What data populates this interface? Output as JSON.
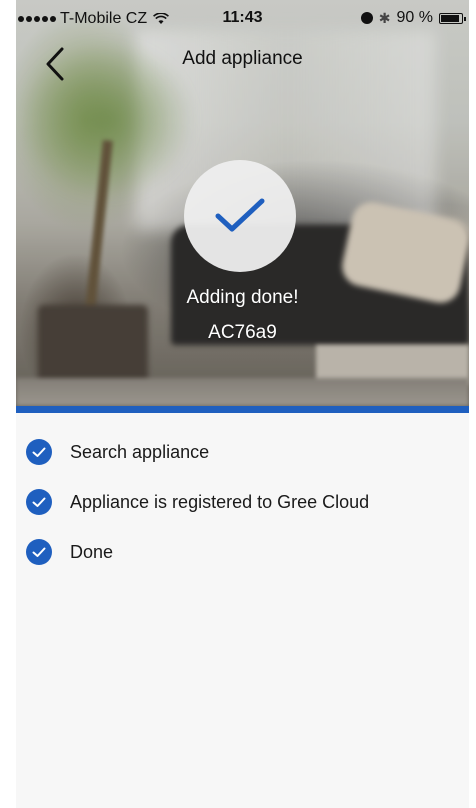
{
  "status_bar": {
    "carrier": "T-Mobile CZ",
    "time": "11:43",
    "battery": "90 %"
  },
  "nav": {
    "title": "Add appliance"
  },
  "result": {
    "message": "Adding done!",
    "device_id": "AC76a9"
  },
  "steps": [
    {
      "label": "Search appliance"
    },
    {
      "label": "Appliance is registered to Gree Cloud"
    },
    {
      "label": "Done"
    }
  ],
  "colors": {
    "accent": "#1f5fbf",
    "background": "#f7f7f7"
  }
}
